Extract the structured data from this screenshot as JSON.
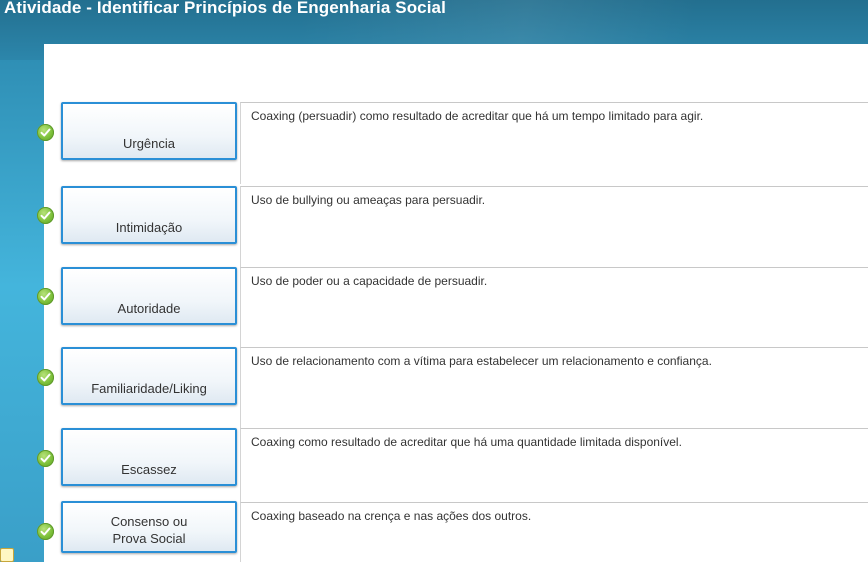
{
  "header": {
    "title": "Atividade - Identificar Princípios de Engenharia Social"
  },
  "colors": {
    "accent_border": "#2a8fd6",
    "check_green": "#7cc03a",
    "background_blue": "#3aa6cc"
  },
  "items": [
    {
      "term": "Urgência",
      "description": "Coaxing (persuadir) como resultado de acreditar que há um tempo limitado para agir.",
      "status_icon": "check-icon"
    },
    {
      "term": "Intimidação",
      "description": "Uso de bullying ou ameaças para persuadir.",
      "status_icon": "check-icon"
    },
    {
      "term": "Autoridade",
      "description": "Uso de poder ou a capacidade de persuadir.",
      "status_icon": "check-icon"
    },
    {
      "term": "Familiaridade/Liking",
      "description": "Uso de relacionamento com a vítima para estabelecer um relacionamento e confiança.",
      "status_icon": "check-icon"
    },
    {
      "term": "Escassez",
      "description": "Coaxing como resultado de acreditar que há uma quantidade limitada disponível.",
      "status_icon": "check-icon"
    },
    {
      "term_line1": "Consenso ou",
      "term_line2": "Prova Social",
      "description": "Coaxing baseado na crença e nas ações dos outros.",
      "status_icon": "check-icon"
    }
  ]
}
